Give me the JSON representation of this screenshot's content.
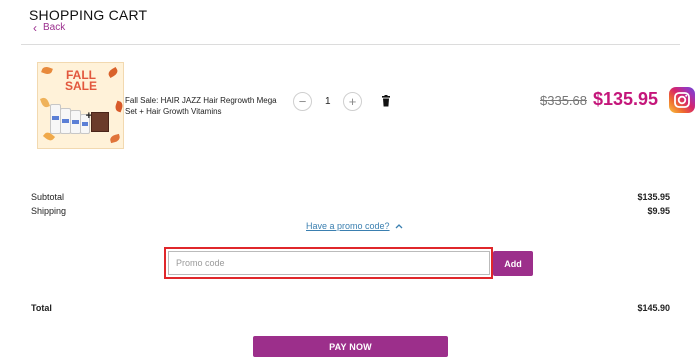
{
  "header": {
    "title": "SHOPPING CART",
    "back_label": "Back"
  },
  "product": {
    "image_text": "FALL SALE",
    "name": "Fall Sale: HAIR JAZZ Hair Regrowth Mega Set + Hair Growth Vitamins",
    "quantity": "1",
    "old_price": "$335.68",
    "price": "$135.95"
  },
  "summary": {
    "subtotal_label": "Subtotal",
    "subtotal_value": "$135.95",
    "shipping_label": "Shipping",
    "shipping_value": "$9.95",
    "total_label": "Total",
    "total_value": "$145.90"
  },
  "promo": {
    "toggle_label": "Have a promo code?",
    "placeholder": "Promo code",
    "add_label": "Add"
  },
  "checkout": {
    "pay_label": "PAY NOW"
  },
  "colors": {
    "accent": "#9c2f8b",
    "price": "#c4167a",
    "highlight": "#e0272b",
    "link": "#3a7fb0"
  },
  "icons": {
    "back": "chevron-left-icon",
    "remove": "trash-icon",
    "social": "instagram-icon",
    "promo_toggle": "chevron-up-icon"
  }
}
